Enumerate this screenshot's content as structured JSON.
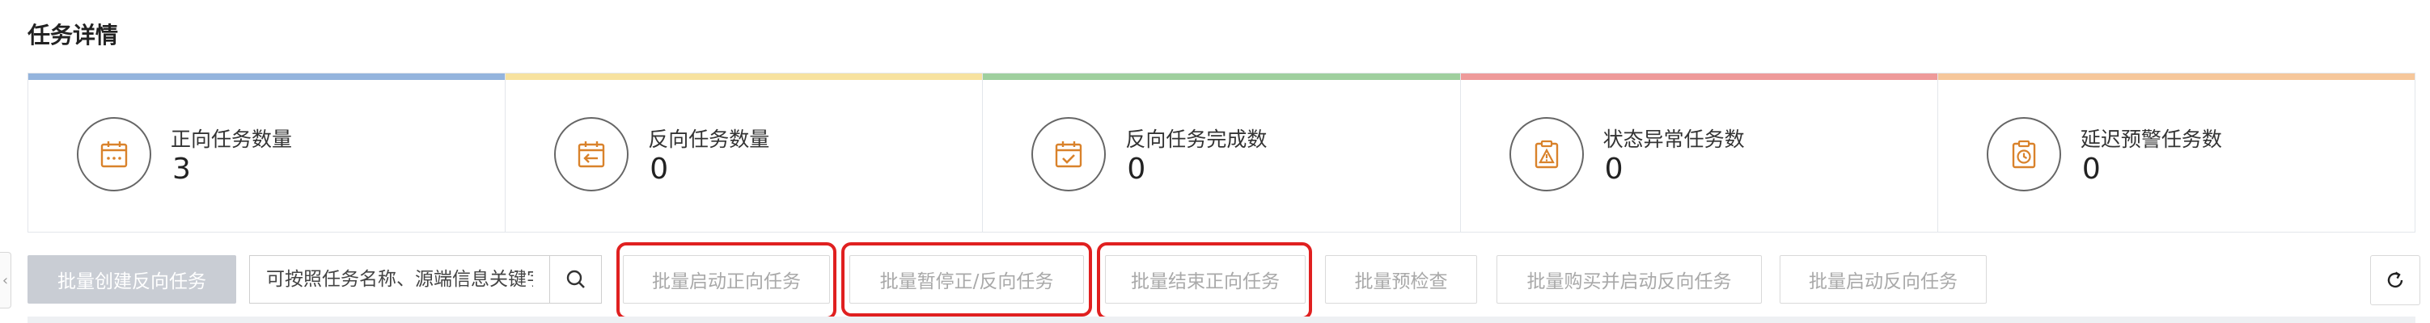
{
  "page": {
    "title": "任务详情"
  },
  "stats": [
    {
      "label": "正向任务数量",
      "value": "3",
      "color": "#94b4dd",
      "icon": "calendar-dots-icon"
    },
    {
      "label": "反向任务数量",
      "value": "0",
      "color": "#f7e29f",
      "icon": "calendar-arrow-left-icon"
    },
    {
      "label": "反向任务完成数",
      "value": "0",
      "color": "#9fcf9e",
      "icon": "calendar-check-icon"
    },
    {
      "label": "状态异常任务数",
      "value": "0",
      "color": "#ee9a9a",
      "icon": "clipboard-warning-icon"
    },
    {
      "label": "延迟预警任务数",
      "value": "0",
      "color": "#f6c79b",
      "icon": "clipboard-clock-icon"
    }
  ],
  "toolbar": {
    "collapse_glyph": "‹",
    "create_reverse": "批量创建反向任务",
    "search_placeholder": "可按照任务名称、源端信息关键字搜索",
    "start_forward": "批量启动正向任务",
    "pause": "批量暂停正/反向任务",
    "end_forward": "批量结束正向任务",
    "precheck": "批量预检查",
    "buy_start_reverse": "批量购买并启动反向任务",
    "start_reverse": "批量启动反向任务"
  },
  "highlight_color": "#e02020"
}
